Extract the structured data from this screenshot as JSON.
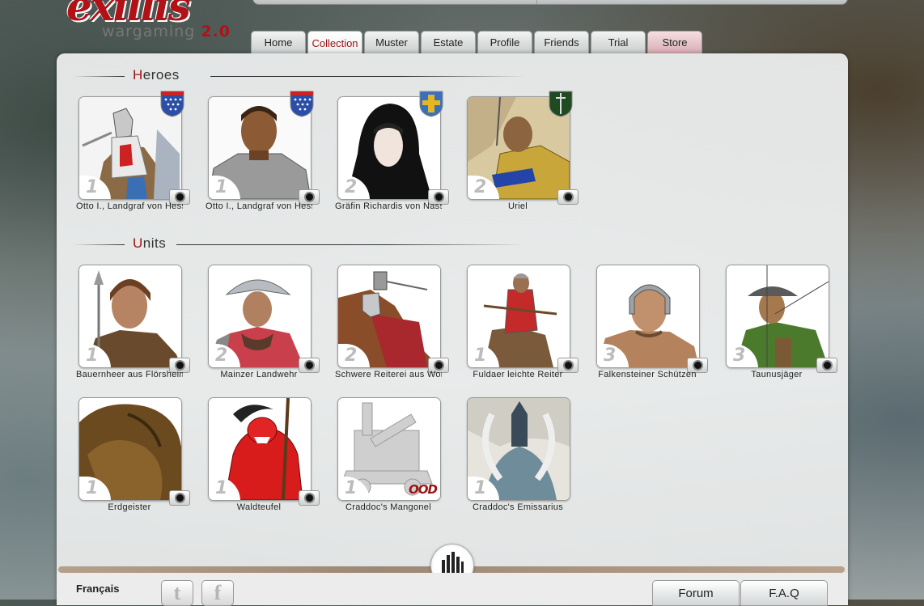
{
  "logo": {
    "part1": "ex",
    "part2": "illis",
    "sub_text": "wargaming",
    "sub_version": "2.0"
  },
  "tabs": [
    {
      "label": "Home",
      "active": false
    },
    {
      "label": "Collection",
      "active": true
    },
    {
      "label": "Muster",
      "active": false
    },
    {
      "label": "Estate",
      "active": false
    },
    {
      "label": "Profile",
      "active": false
    },
    {
      "label": "Friends",
      "active": false
    },
    {
      "label": "Trial",
      "active": false
    },
    {
      "label": "Store",
      "active": false
    }
  ],
  "heroes": {
    "title": "Heroes",
    "cards": [
      {
        "name": "Otto I., Landgraf von Hessen",
        "cost": "1",
        "crest": "blue-red-cross-crest-icon"
      },
      {
        "name": "Otto I., Landgraf von Hessen",
        "cost": "1",
        "crest": "blue-red-cross-crest-icon"
      },
      {
        "name": "Gräfin Richardis von Nassau",
        "cost": "2",
        "crest": "blue-gold-cross-crest-icon"
      },
      {
        "name": "Uriel",
        "cost": "2",
        "crest": "green-sword-crest-icon"
      }
    ]
  },
  "units": {
    "title": "Units",
    "cards": [
      {
        "name": "Bauernheer aus Flörsheim",
        "cost": "1"
      },
      {
        "name": "Mainzer Landwehr",
        "cost": "2"
      },
      {
        "name": "Schwere Reiterei aus Worms",
        "cost": "2"
      },
      {
        "name": "Fuldaer leichte Reiter",
        "cost": "1"
      },
      {
        "name": "Falkensteiner Schützen",
        "cost": "3"
      },
      {
        "name": "Taunusjäger",
        "cost": "3"
      },
      {
        "name": "Erdgeister",
        "cost": "1"
      },
      {
        "name": "Waldteufel",
        "cost": "1"
      },
      {
        "name": "Craddoc's Mangonel",
        "cost": "1",
        "badge": "OOD"
      },
      {
        "name": "Craddoc's Emissarius",
        "cost": "1"
      }
    ]
  },
  "footer": {
    "language": "Français",
    "social": [
      {
        "name": "twitter",
        "glyph": "t"
      },
      {
        "name": "facebook",
        "glyph": "f"
      }
    ],
    "forum_label": "Forum",
    "faq_label": "F.A.Q"
  },
  "colors": {
    "accent": "#9b1414",
    "panel": "#e9ebeb"
  }
}
